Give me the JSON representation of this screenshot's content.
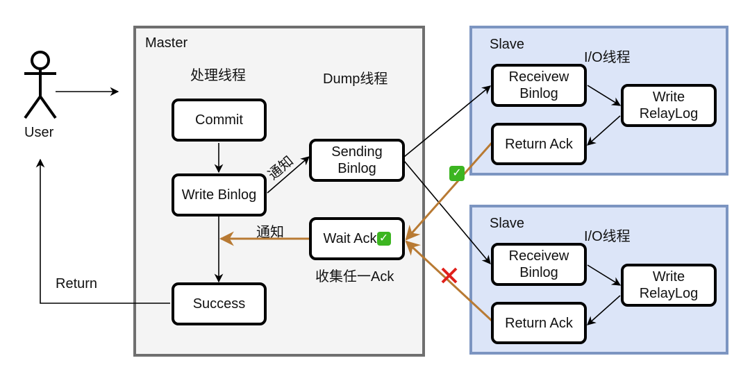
{
  "user": {
    "label": "User",
    "return_label": "Return"
  },
  "master": {
    "title": "Master",
    "process_thread_label": "处理线程",
    "dump_thread_label": "Dump线程",
    "nodes": {
      "commit": "Commit",
      "write_binlog": "Write Binlog",
      "success": "Success",
      "sending_binlog": "Sending\nBinlog",
      "wait_ack": "Wait Ack"
    },
    "notify_label_1": "通知",
    "notify_label_2": "通知",
    "collect_label": "收集任一Ack",
    "wait_ack_status_icon": "check-mark-button"
  },
  "slaves": [
    {
      "title": "Slave",
      "io_thread_label": "I/O线程",
      "nodes": {
        "receive_binlog": "Receivew\nBinlog",
        "write_relaylog": "Write\nRelayLog",
        "return_ack": "Return Ack"
      },
      "ack_status": "success"
    },
    {
      "title": "Slave",
      "io_thread_label": "I/O线程",
      "nodes": {
        "receive_binlog": "Receivew\nBinlog",
        "write_relaylog": "Write\nRelayLog",
        "return_ack": "Return Ack"
      },
      "ack_status": "failed"
    }
  ],
  "colors": {
    "ack_arrow": "#b87a33",
    "success_check": "#3cb521",
    "fail_cross": "#e0201b",
    "slave_fill": "#dce5f8",
    "slave_border": "#7c95c1",
    "master_fill": "#f4f4f4",
    "master_border": "#6f6f6f"
  }
}
